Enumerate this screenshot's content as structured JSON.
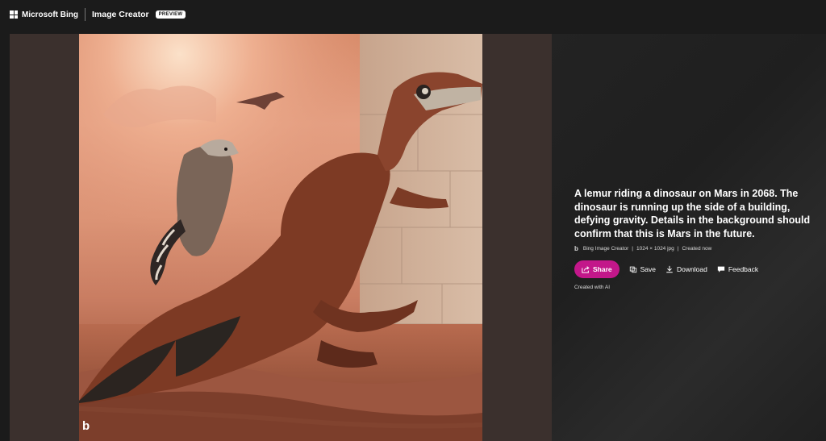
{
  "header": {
    "brand": "Microsoft Bing",
    "product": "Image Creator",
    "badge": "PREVIEW"
  },
  "image": {
    "watermark_icon": "bing-b-logo"
  },
  "details": {
    "caption": "A lemur riding a dinosaur on Mars in 2068. The dinosaur is running up the side of a building, defying gravity. Details in the background should confirm that this is Mars in the future.",
    "source": "Bing Image Creator",
    "separator1": "|",
    "size": "1024 × 1024 jpg",
    "separator2": "|",
    "created": "Created now",
    "share_label": "Share",
    "save_label": "Save",
    "download_label": "Download",
    "feedback_label": "Feedback",
    "created_with": "Created with AI",
    "accent": "#c3178a"
  }
}
